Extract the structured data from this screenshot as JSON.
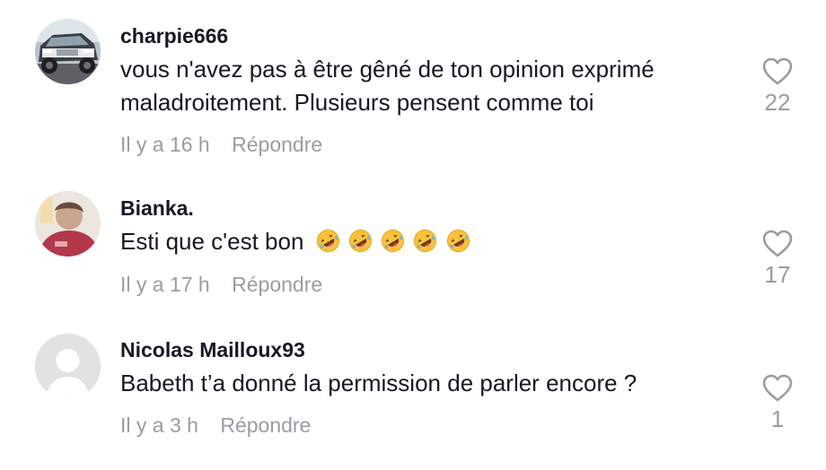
{
  "comments": [
    {
      "username": "charpie666",
      "text": "vous n'avez pas à être gêné de ton opinion exprimé maladroitement. Plusieurs pensent comme toi",
      "time": "Il y a 16 h",
      "reply_label": "Répondre",
      "likes": "22",
      "avatar_icon": "truck-photo-avatar"
    },
    {
      "username": "Bianka.",
      "text": "Esti que c'est bon",
      "emojis": [
        "rolling-on-floor-laughing",
        "rolling-on-floor-laughing",
        "rolling-on-floor-laughing",
        "rolling-on-floor-laughing",
        "rolling-on-floor-laughing"
      ],
      "time": "Il y a 17 h",
      "reply_label": "Répondre",
      "likes": "17",
      "avatar_icon": "person-photo-avatar"
    },
    {
      "username": "Nicolas Mailloux93",
      "text": "Babeth t’a donné la permission de parler encore ?",
      "time": "Il y a 3 h",
      "reply_label": "Répondre",
      "likes": "1",
      "avatar_icon": "default-user-avatar"
    }
  ],
  "colors": {
    "text": "#161823",
    "muted": "#9b9ca1",
    "background": "#ffffff"
  }
}
